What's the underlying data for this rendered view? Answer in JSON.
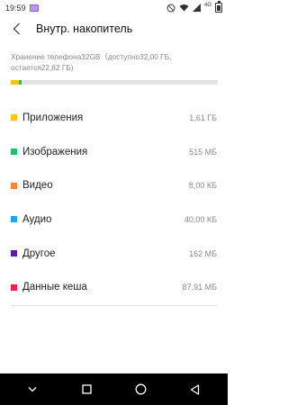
{
  "status_bar": {
    "time": "19:59",
    "network": "4G"
  },
  "header": {
    "title": "Внутр. накопитель"
  },
  "storage": {
    "info_line1": "Хранение телефона32GB（доступно32,00 ГБ,",
    "info_line2": "остается22,82 ГБ)",
    "segments": [
      {
        "name": "apps",
        "color": "#f5c518",
        "fraction": 0.04
      },
      {
        "name": "images",
        "color": "#2bb673",
        "fraction": 0.012
      }
    ]
  },
  "categories": [
    {
      "label": "Приложения",
      "size": "1,61 ГБ",
      "color": "#f5c518"
    },
    {
      "label": "Изображения",
      "size": "515 МБ",
      "color": "#2bb673"
    },
    {
      "label": "Видео",
      "size": "8,00 КБ",
      "color": "#f5863a"
    },
    {
      "label": "Аудио",
      "size": "40,00 КБ",
      "color": "#27a4e8"
    },
    {
      "label": "Другое",
      "size": "162 МБ",
      "color": "#5b1f9e"
    },
    {
      "label": "Данные кеша",
      "size": "87,91 МБ",
      "color": "#e0284b"
    }
  ]
}
